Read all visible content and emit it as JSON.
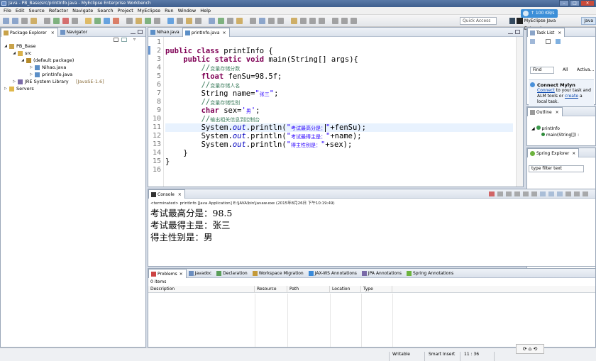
{
  "window": {
    "title": "Java - PB_Base/src/printInfo.java - MyEclipse Enterprise Workbench"
  },
  "menu": [
    "File",
    "Edit",
    "Source",
    "Refactor",
    "Navigate",
    "Search",
    "Project",
    "MyEclipse",
    "Run",
    "Window",
    "Help"
  ],
  "toolbar": {
    "quick_access_placeholder": "Quick Access",
    "perspective_label": "MyEclipse Java Enterprise",
    "java_label": "Java"
  },
  "net_badge": "↑ 100 KB/s",
  "package_explorer": {
    "tabs": [
      "Package Explorer",
      "Navigator"
    ],
    "tree": [
      {
        "label": "PB_Base",
        "depth": 0,
        "arrow": "◢",
        "icon": "project"
      },
      {
        "label": "src",
        "depth": 1,
        "arrow": "◢",
        "icon": "src"
      },
      {
        "label": "(default package)",
        "depth": 2,
        "arrow": "◢",
        "icon": "package"
      },
      {
        "label": "Nihao.java",
        "depth": 3,
        "arrow": "▷",
        "icon": "java"
      },
      {
        "label": "printInfo.java",
        "depth": 3,
        "arrow": "▷",
        "icon": "java"
      },
      {
        "label": "JRE System Library",
        "extra": "[JavaSE-1.6]",
        "depth": 1,
        "arrow": "▷",
        "icon": "library"
      },
      {
        "label": "Servers",
        "depth": 0,
        "arrow": "▷",
        "icon": "folder"
      }
    ]
  },
  "editor": {
    "tabs": [
      {
        "label": "Nihao.java",
        "active": false
      },
      {
        "label": "printInfo.java",
        "active": true
      }
    ],
    "lines": [
      [],
      [
        [
          "kw",
          "public class "
        ],
        [
          "",
          "printInfo {"
        ]
      ],
      [
        [
          "",
          "    "
        ],
        [
          "kw",
          "public static void "
        ],
        [
          "",
          "main(String[] args){"
        ]
      ],
      [
        [
          "",
          "        "
        ],
        [
          "cm",
          "//"
        ],
        [
          "cm cjk",
          "变量存储分数"
        ]
      ],
      [
        [
          "",
          "        "
        ],
        [
          "kw",
          "float "
        ],
        [
          "",
          "fenSu=98.5f;"
        ]
      ],
      [
        [
          "",
          "        "
        ],
        [
          "cm",
          "//"
        ],
        [
          "cm cjk",
          "变量存储人名"
        ]
      ],
      [
        [
          "",
          "        String name="
        ],
        [
          "st",
          "\""
        ],
        [
          "st cjk",
          "张三"
        ],
        [
          "st",
          "\""
        ],
        [
          "",
          ";"
        ]
      ],
      [
        [
          "",
          "        "
        ],
        [
          "cm",
          "//"
        ],
        [
          "cm cjk",
          "变量存储性别"
        ]
      ],
      [
        [
          "",
          "        "
        ],
        [
          "kw",
          "char "
        ],
        [
          "",
          "sex="
        ],
        [
          "st",
          "'"
        ],
        [
          "st cjk",
          "男"
        ],
        [
          "st",
          "'"
        ],
        [
          "",
          ";"
        ]
      ],
      [
        [
          "",
          "        "
        ],
        [
          "cm",
          "//"
        ],
        [
          "cm cjk",
          "输出相关信息到控制台"
        ]
      ],
      [
        [
          "",
          "        System."
        ],
        [
          "fd",
          "out"
        ],
        [
          "",
          ".println("
        ],
        [
          "st",
          "\""
        ],
        [
          "st cjk",
          "考试最高分是："
        ],
        [
          "st",
          "\""
        ],
        [
          "",
          "+fenSu);"
        ]
      ],
      [
        [
          "",
          "        System."
        ],
        [
          "fd",
          "out"
        ],
        [
          "",
          ".println("
        ],
        [
          "st",
          "\""
        ],
        [
          "st cjk",
          "考试最得主是："
        ],
        [
          "st",
          "\""
        ],
        [
          "",
          "+name);"
        ]
      ],
      [
        [
          "",
          "        System."
        ],
        [
          "fd",
          "out"
        ],
        [
          "",
          ".println("
        ],
        [
          "st",
          "\""
        ],
        [
          "st cjk",
          "得主性别是："
        ],
        [
          "st",
          "\""
        ],
        [
          "",
          "+sex);"
        ]
      ],
      [
        [
          "",
          "    }"
        ]
      ],
      [
        [
          "",
          "}"
        ]
      ],
      []
    ]
  },
  "task_list": {
    "tab": "Task List",
    "find_placeholder": "Find",
    "all_label": "All",
    "activate_label": "Activa...",
    "mylyn_title": "Connect Mylyn",
    "mylyn_connect": "Connect",
    "mylyn_text_1": " to your task and",
    "mylyn_text_2": "ALM tools or ",
    "mylyn_create": "create",
    "mylyn_text_3": " a",
    "mylyn_text_4": "local task."
  },
  "outline": {
    "tab": "Outline",
    "class_name": "printInfo",
    "method_name": "main(String[]) :"
  },
  "spring_explorer": {
    "tab": "Spring Explorer",
    "filter_placeholder": "type filter text"
  },
  "console": {
    "tab": "Console",
    "meta": "<terminated> printInfo [Java Application] E:\\JAVA\\bin\\javaw.exe (2015年8月26日 下午10:19:49)",
    "output": [
      "考试最高分是：98.5",
      "考试最得主是：张三",
      "得主性别是：男"
    ]
  },
  "problems": {
    "tabs": [
      "Problems",
      "Javadoc",
      "Declaration",
      "Workspace Migration",
      "JAX-WS Annotations",
      "JPA Annotations",
      "Spring Annotations"
    ],
    "count": "0 items",
    "columns": [
      "Description",
      "Resource",
      "Path",
      "Location",
      "Type"
    ]
  },
  "status": {
    "writable": "Writable",
    "insert_mode": "Smart Insert",
    "position": "11 : 36"
  },
  "colors": {
    "keyword": "#7f0055",
    "comment": "#3f7f5f",
    "string": "#2a00ff",
    "field": "#0000c0",
    "accent": "#3c8fd8"
  }
}
